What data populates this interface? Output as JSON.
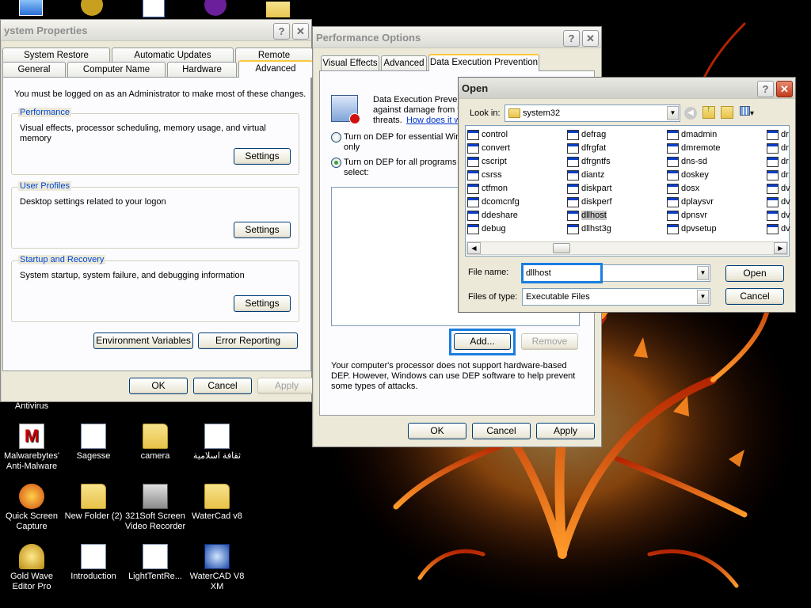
{
  "desktop": {
    "icons": [
      {
        "label": "Antivirus",
        "type": "text-only"
      },
      {
        "label": "Malwarebytes' Anti-Malware",
        "type": "malwarebytes"
      },
      {
        "label": "Sagesse",
        "type": "doc"
      },
      {
        "label": "camera",
        "type": "folder"
      },
      {
        "label": "ثقافة اسلامية",
        "type": "doc"
      },
      {
        "label": "Quick Screen Capture",
        "type": "app"
      },
      {
        "label": "New Folder (2)",
        "type": "folder"
      },
      {
        "label": "321Soft Screen Video Recorder",
        "type": "app"
      },
      {
        "label": "WaterCad v8",
        "type": "folder"
      },
      {
        "label": "Gold Wave Editor Pro",
        "type": "app"
      },
      {
        "label": "Introduction",
        "type": "doc"
      },
      {
        "label": "LightTentRe...",
        "type": "doc"
      },
      {
        "label": "WaterCAD V8 XM",
        "type": "app"
      }
    ]
  },
  "system_properties": {
    "title": "ystem Properties",
    "help_btn": "?",
    "close_btn": "✕",
    "tabs_row1": [
      "System Restore",
      "Automatic Updates",
      "Remote"
    ],
    "tabs_row2": [
      "General",
      "Computer Name",
      "Hardware",
      "Advanced"
    ],
    "admin_note": "You must be logged on as an Administrator to make most of these changes.",
    "performance": {
      "title": "Performance",
      "desc": "Visual effects, processor scheduling, memory usage, and virtual memory",
      "button": "Settings"
    },
    "user_profiles": {
      "title": "User Profiles",
      "desc": "Desktop settings related to your logon",
      "button": "Settings"
    },
    "startup": {
      "title": "Startup and Recovery",
      "desc": "System startup, system failure, and debugging information",
      "button": "Settings"
    },
    "env_button": "Environment Variables",
    "error_button": "Error Reporting",
    "ok": "OK",
    "cancel": "Cancel",
    "apply": "Apply"
  },
  "performance_options": {
    "title": "Performance Options",
    "help_btn": "?",
    "close_btn": "✕",
    "tabs": [
      "Visual Effects",
      "Advanced",
      "Data Execution Prevention"
    ],
    "dep_text_1": "Data Execution Preven",
    "dep_text_2": "against damage from v",
    "dep_text_3": "threats.",
    "dep_link": "How does it w",
    "radio1_line1": "Turn on DEP for essential Wind",
    "radio1_line2": "only",
    "radio2_line1": "Turn on DEP for all programs a",
    "radio2_line2": "select:",
    "add_button": "Add...",
    "remove_button": "Remove",
    "processor_note": "Your computer's processor does not support hardware-based DEP. However, Windows can use DEP software to help prevent some types of attacks.",
    "ok": "OK",
    "cancel": "Cancel",
    "apply": "Apply"
  },
  "open_dialog": {
    "title": "Open",
    "help_btn": "?",
    "close_btn": "✕",
    "look_in_label": "Look in:",
    "look_in_value": "system32",
    "files": [
      [
        "control",
        "defrag",
        "dmadmin",
        "dr"
      ],
      [
        "convert",
        "dfrgfat",
        "dmremote",
        "dr"
      ],
      [
        "cscript",
        "dfrgntfs",
        "dns-sd",
        "dr"
      ],
      [
        "csrss",
        "diantz",
        "doskey",
        "dr"
      ],
      [
        "ctfmon",
        "diskpart",
        "dosx",
        "dv"
      ],
      [
        "dcomcnfg",
        "diskperf",
        "dplaysvr",
        "dv"
      ],
      [
        "ddeshare",
        "dllhost",
        "dpnsvr",
        "dv"
      ],
      [
        "debug",
        "dllhst3g",
        "dpvsetup",
        "dv"
      ]
    ],
    "selected_file": "dllhost",
    "file_name_label": "File name:",
    "file_name_value": "dllhost",
    "files_of_type_label": "Files of type:",
    "files_of_type_value": "Executable Files",
    "open_button": "Open",
    "cancel_button": "Cancel"
  }
}
